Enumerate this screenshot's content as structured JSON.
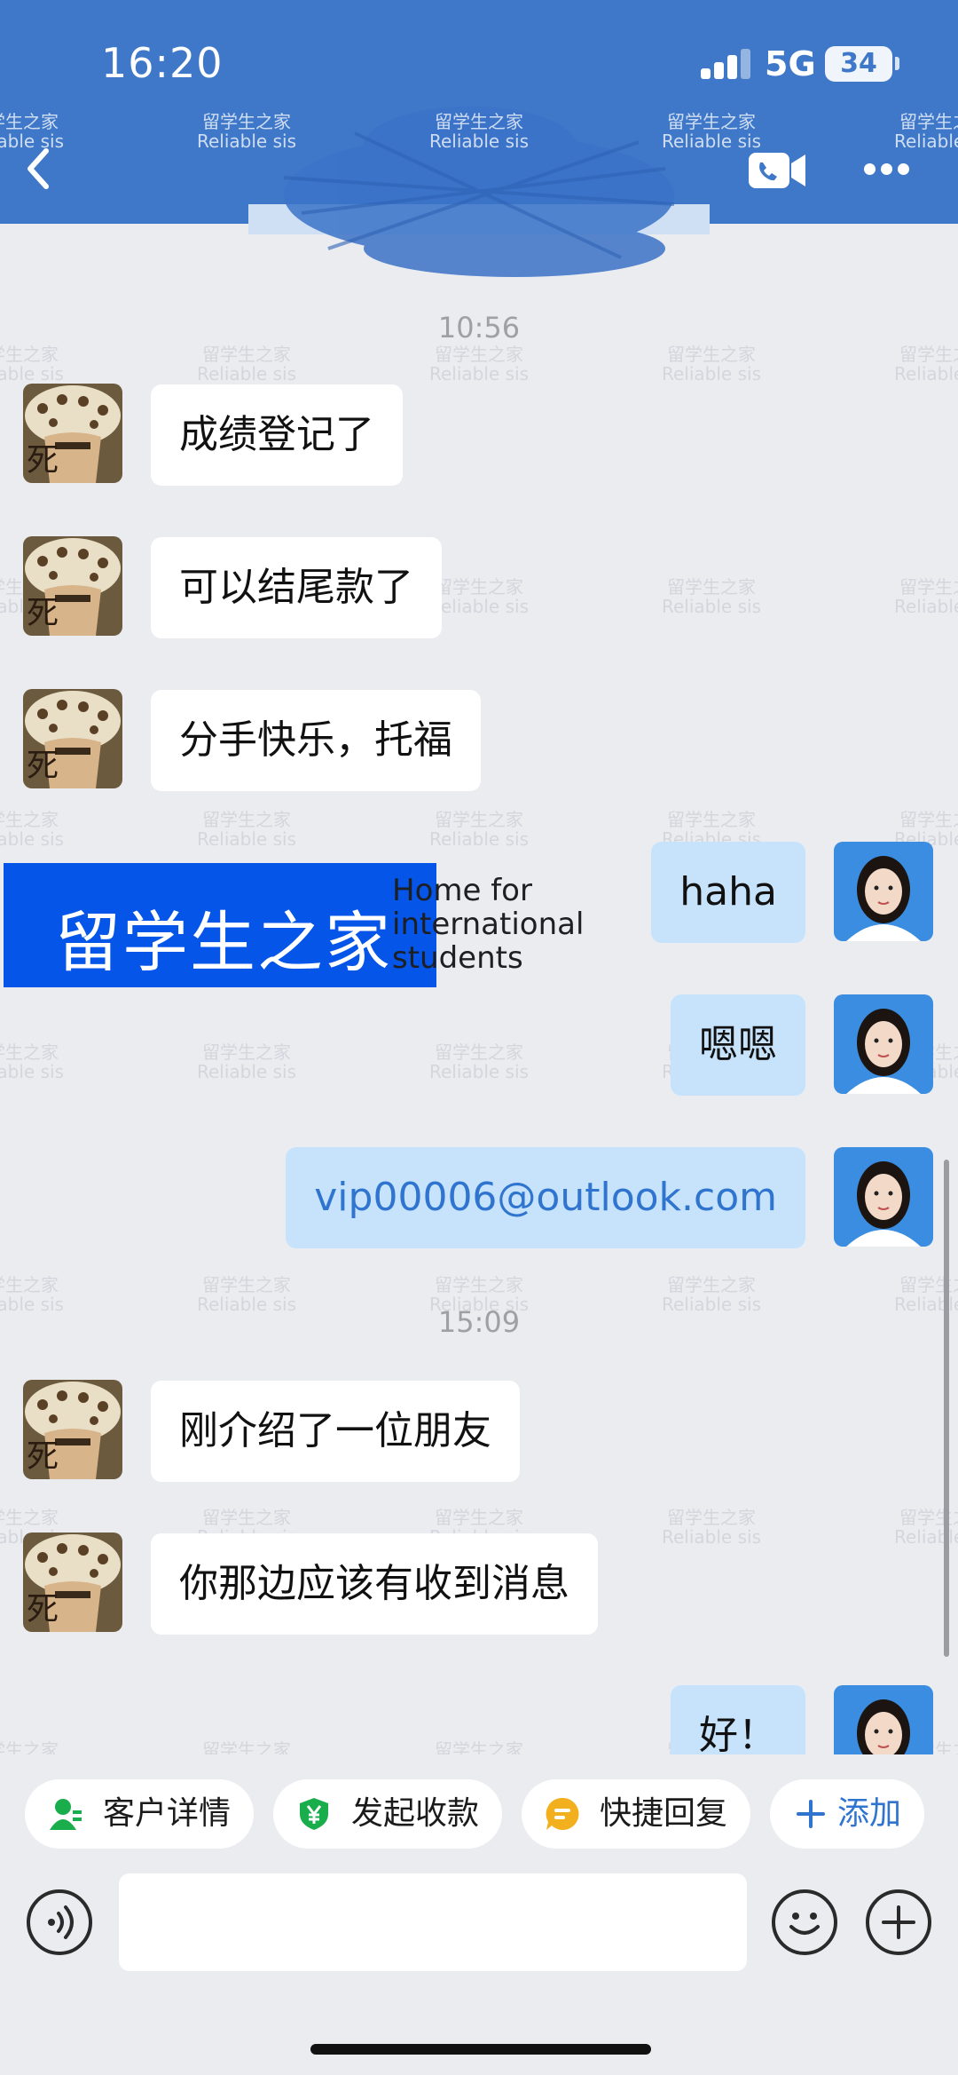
{
  "status_bar": {
    "time": "16:20",
    "network": "5G",
    "battery": "34"
  },
  "watermark": {
    "cn": "留学生之家",
    "en": "Reliable sis"
  },
  "messages": [
    {
      "type": "time",
      "text": "10:56"
    },
    {
      "type": "in",
      "text": "成绩登记了"
    },
    {
      "type": "in",
      "text": "可以结尾款了"
    },
    {
      "type": "in",
      "text": "分手快乐，托福"
    },
    {
      "type": "out",
      "text": "haha"
    },
    {
      "type": "out",
      "text": "嗯嗯"
    },
    {
      "type": "out",
      "text": "vip00006@outlook.com"
    },
    {
      "type": "time",
      "text": "15:09"
    },
    {
      "type": "in",
      "text": "刚介绍了一位朋友"
    },
    {
      "type": "in",
      "text": "你那边应该有收到消息"
    },
    {
      "type": "out",
      "text": "好！"
    }
  ],
  "brand": {
    "cn": "留学生之家",
    "en_line1": "Home for",
    "en_line2": "international",
    "en_line3": "students"
  },
  "quick_actions": {
    "customer_details": "客户详情",
    "request_payment": "发起收款",
    "quick_reply": "快捷回复",
    "add": "添加"
  },
  "colors": {
    "header": "#3f78c8",
    "bubble_out": "#c6e3fb",
    "bubble_in": "#ffffff",
    "email_link": "#2f74cf",
    "brand_bg": "#0455e8"
  }
}
